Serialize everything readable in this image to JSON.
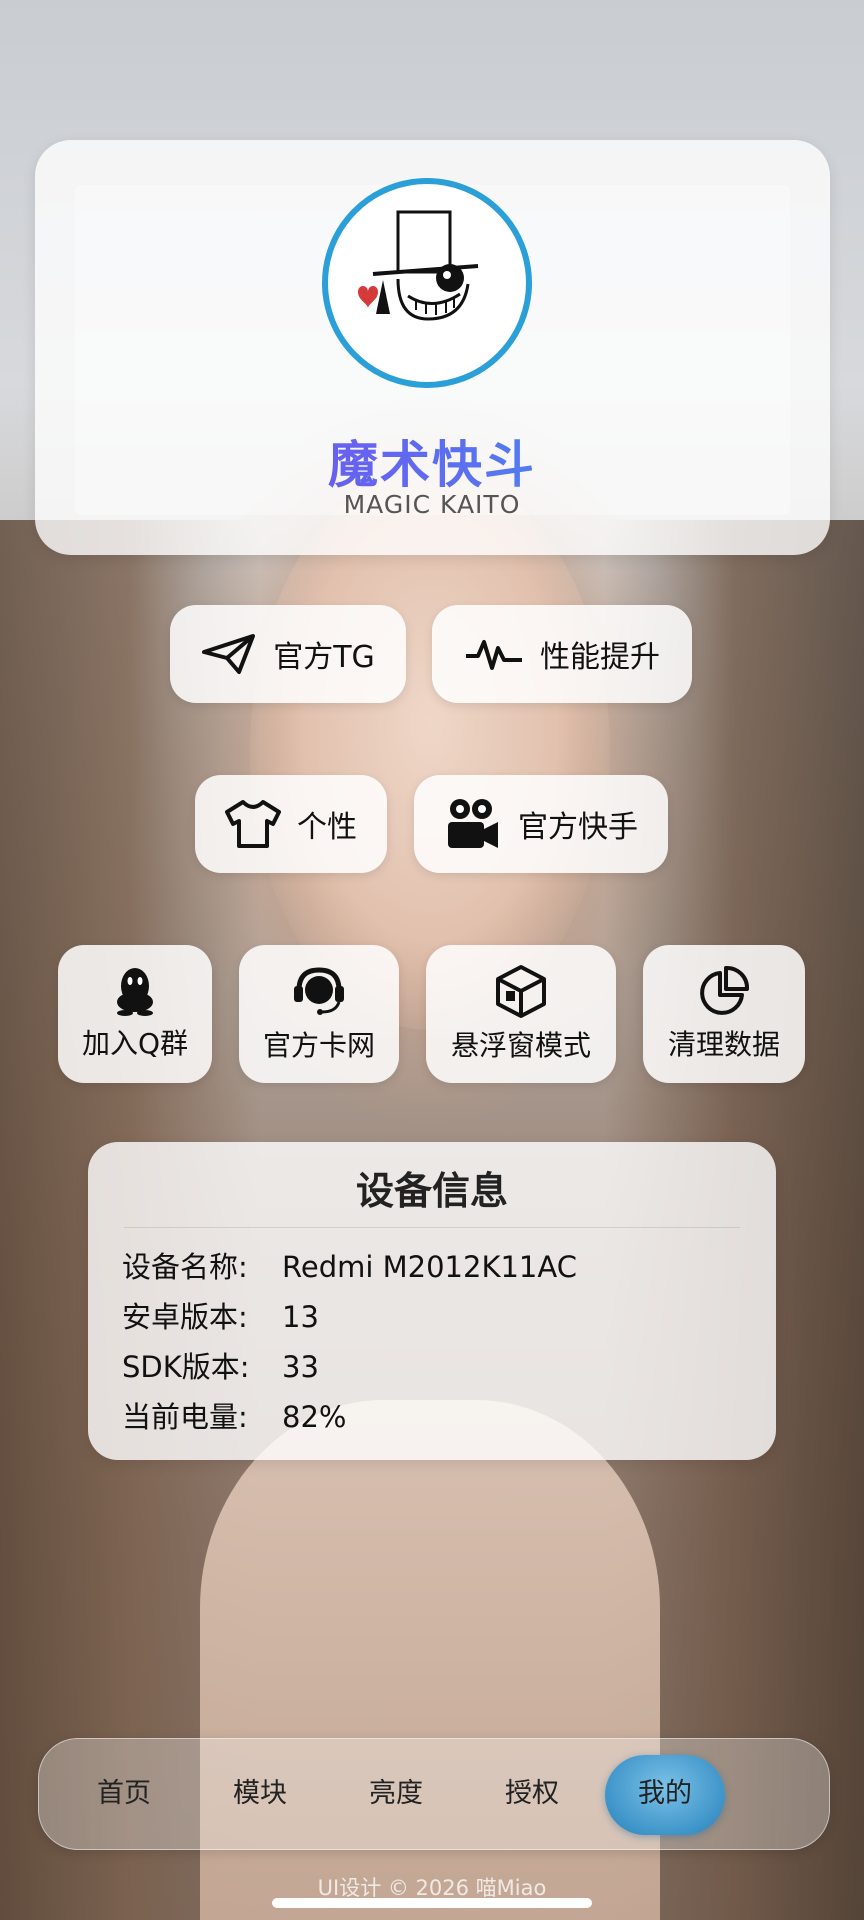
{
  "profile": {
    "title_cn": "魔术快斗",
    "title_en": "MAGIC KAITO"
  },
  "buttons_row1": [
    {
      "label": "官方TG",
      "icon": "send-icon"
    },
    {
      "label": "性能提升",
      "icon": "pulse-icon"
    }
  ],
  "buttons_row2": [
    {
      "label": "个性",
      "icon": "tshirt-icon"
    },
    {
      "label": "官方快手",
      "icon": "video-camera-icon"
    }
  ],
  "tiles": [
    {
      "label": "加入Q群",
      "icon": "qq-penguin-icon"
    },
    {
      "label": "官方卡网",
      "icon": "headset-icon"
    },
    {
      "label": "悬浮窗模式",
      "icon": "cube-icon"
    },
    {
      "label": "清理数据",
      "icon": "pie-chart-icon"
    }
  ],
  "device_info": {
    "title": "设备信息",
    "rows": [
      {
        "key": "设备名称:",
        "value": "Redmi M2012K11AC"
      },
      {
        "key": "安卓版本:",
        "value": "13"
      },
      {
        "key": "SDK版本:",
        "value": "33"
      },
      {
        "key": "当前电量:",
        "value": "82%"
      }
    ]
  },
  "tabbar": {
    "tabs": [
      "首页",
      "模块",
      "亮度",
      "授权",
      "我的"
    ],
    "active": "我的",
    "active_color": "#3f95c9"
  },
  "footer": "UI设计 © 2026 喵Miao",
  "colors": {
    "avatar_ring": "#2a9fd8",
    "title_gradient_start": "#8a3df0",
    "title_gradient_end": "#29b5ea"
  }
}
